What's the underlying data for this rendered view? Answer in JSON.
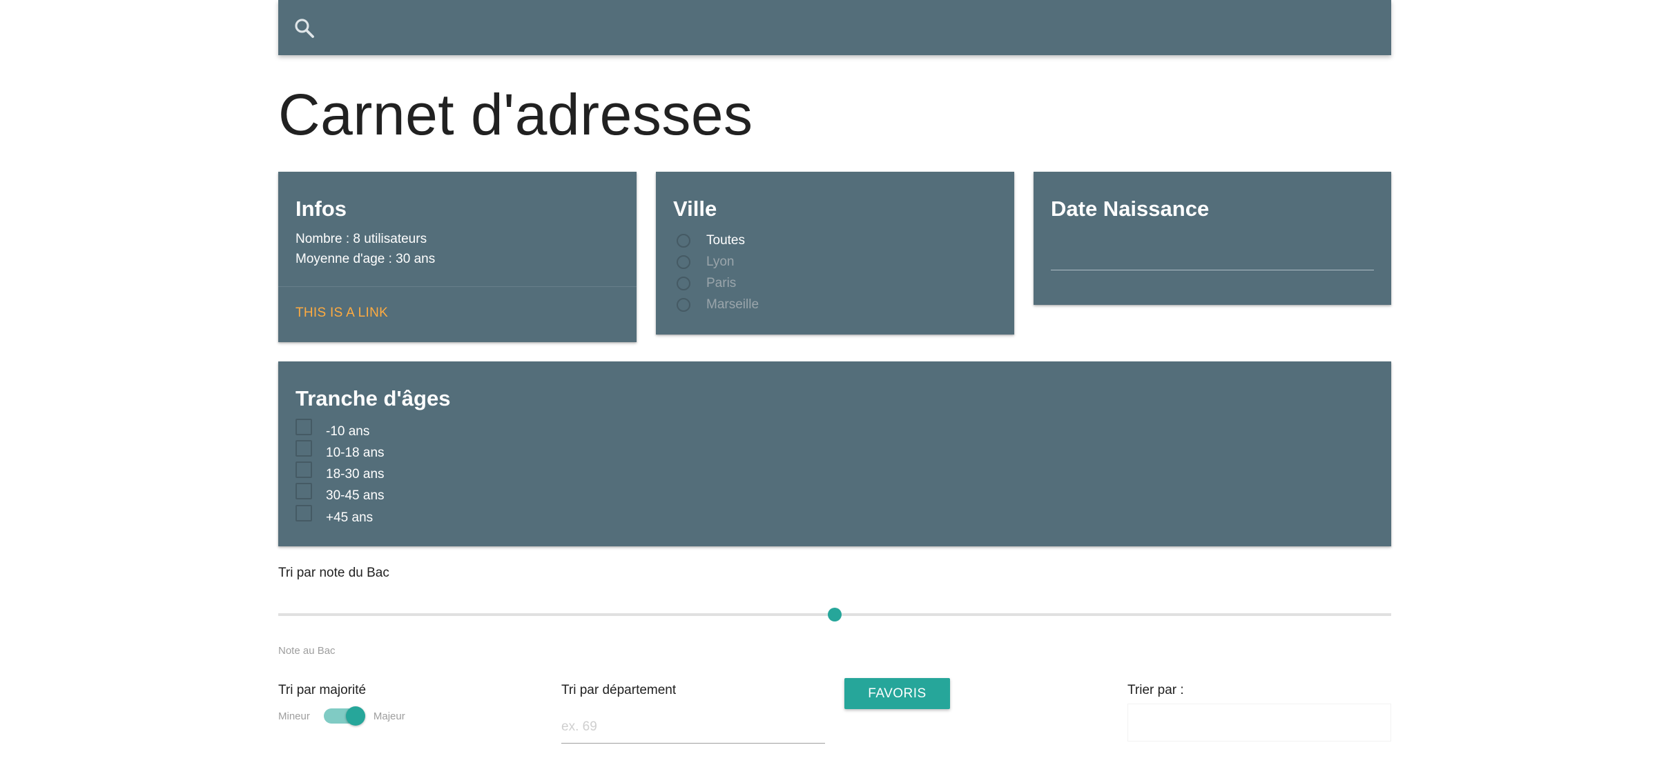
{
  "search": {
    "icon": "search-icon"
  },
  "page": {
    "title": "Carnet d'adresses"
  },
  "infos": {
    "title": "Infos",
    "count_text": "Nombre : 8 utilisateurs",
    "avg_text": "Moyenne d'age : 30 ans",
    "link_label": "This is a link",
    "link_color": "#ffab40"
  },
  "ville": {
    "title": "Ville",
    "options": [
      {
        "label": "Toutes",
        "selected": true
      },
      {
        "label": "Lyon",
        "selected": false
      },
      {
        "label": "Paris",
        "selected": false
      },
      {
        "label": "Marseille",
        "selected": false
      }
    ]
  },
  "date": {
    "title": "Date Naissance",
    "value": ""
  },
  "ages": {
    "title": "Tranche d'âges",
    "options": [
      "-10 ans",
      "10-18 ans",
      "18-30 ans",
      "30-45 ans",
      "+45 ans"
    ]
  },
  "bac_slider": {
    "title": "Tri par note du Bac",
    "hint": "Note au Bac",
    "position_fraction": 0.5
  },
  "majorite": {
    "title": "Tri par majorité",
    "left_label": "Mineur",
    "right_label": "Majeur",
    "checked": true
  },
  "departement": {
    "title": "Tri par département",
    "placeholder": "ex. 69",
    "value": ""
  },
  "favoris": {
    "label": "Favoris"
  },
  "sort": {
    "title": "Trier par :",
    "value": ""
  },
  "colors": {
    "card_bg": "#546e7a",
    "accent": "#26a69a",
    "link": "#ffab40"
  }
}
